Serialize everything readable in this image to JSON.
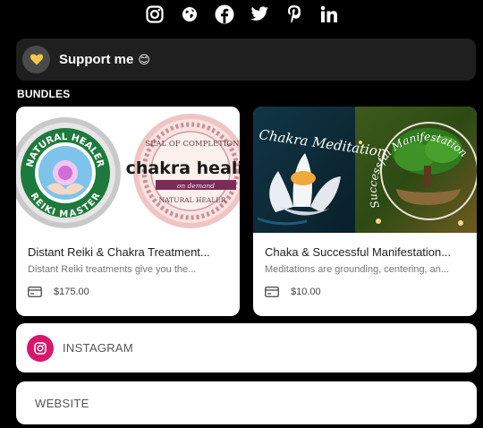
{
  "social": {
    "icons": [
      "instagram-icon",
      "globe-icon",
      "facebook-icon",
      "twitter-icon",
      "pinterest-icon",
      "linkedin-icon"
    ]
  },
  "support": {
    "label": "Support me",
    "emoji": "😊",
    "icon": "heart-icon",
    "heart_color": "#f7c84a"
  },
  "bundles": {
    "section_label": "BUNDLES",
    "items": [
      {
        "title": "Distant Reiki & Chakra Treatment...",
        "description": "Distant Reiki treatments give you the...",
        "price": "$175.00",
        "image": {
          "badge_top": "NATURAL HEALER",
          "badge_bottom": "REIKI MASTER",
          "seal_top": "SEAL OF COMPLETION",
          "seal_main": "chakra healin",
          "seal_ribbon": "on demand",
          "seal_bottom": "NATURAL HEALER"
        }
      },
      {
        "title": "Chaka & Successful Manifestation...",
        "description": "Meditations are grounding, centering, an...",
        "price": "$10.00",
        "image": {
          "left_text": "Chakra Meditation",
          "right_text": "Successful Manifestation"
        }
      }
    ]
  },
  "links": {
    "instagram": "INSTAGRAM",
    "website": "WEBSITE"
  },
  "colors": {
    "background": "#000000",
    "card": "#ffffff",
    "instagram_accent": "#d6186d"
  }
}
